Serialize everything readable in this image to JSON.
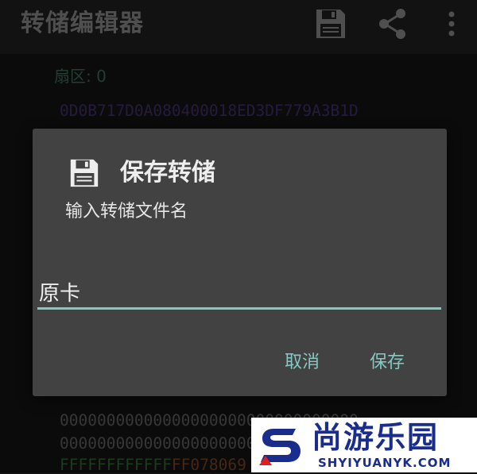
{
  "app_bar": {
    "title": "转储编辑器",
    "actions": [
      {
        "icon": "floppy-disk-icon",
        "label": "save"
      },
      {
        "icon": "share-icon",
        "label": "share"
      },
      {
        "icon": "more-vert-icon",
        "label": "more"
      }
    ]
  },
  "content": {
    "sector_label": "扇区: 0",
    "uid_line": "0D0B717D0A080400018ED3DF779A3B1D",
    "hex_rows": [
      "00000000000000000000000000000000",
      "00000000000000000000000000000000"
    ],
    "trailer_key_a": "FFFFFFFFFFFF",
    "trailer_access": "FF078069"
  },
  "dialog": {
    "icon": "floppy-disk-icon",
    "title": "保存转储",
    "message": "输入转储文件名",
    "input_value": "原卡",
    "cancel_label": "取消",
    "save_label": "保存",
    "accent_color": "#80cbc4"
  },
  "watermark": {
    "cn": "尚游乐园",
    "en": "SHYIYUANYK.COM"
  }
}
